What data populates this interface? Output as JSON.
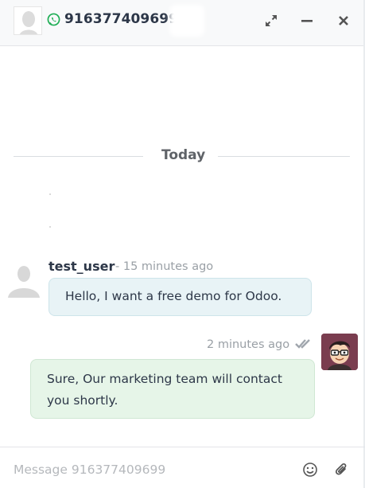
{
  "header": {
    "title": "916377409699",
    "avatar_icon": "user-avatar-icon",
    "channel_icon": "whatsapp-icon",
    "actions": [
      {
        "name": "expand-icon",
        "label": "Expand"
      },
      {
        "name": "minimize-icon",
        "label": "Minimize"
      },
      {
        "name": "close-icon",
        "label": "Close"
      }
    ]
  },
  "separator": {
    "label": "Today"
  },
  "messages": [
    {
      "author": "test_user",
      "time": "- 15 minutes ago",
      "body": "Hello, I want a free demo for Odoo.",
      "avatar_icon": "default-user-avatar-icon",
      "align": "left"
    },
    {
      "author": "",
      "time": "2 minutes ago",
      "body": "Sure, Our marketing team will contact you shortly.",
      "status_icon": "double-check-icon",
      "avatar_icon": "cartoon-user-avatar-icon",
      "align": "right"
    }
  ],
  "composer": {
    "placeholder": "Message 916377409699",
    "value": "",
    "icons": [
      "emoji-icon",
      "paperclip-icon"
    ]
  },
  "colors": {
    "header_bg": "#f8f9fa",
    "incoming_bubble": "#e8f3f6",
    "outgoing_bubble": "#e6f5e8",
    "whatsapp_green": "#25d366"
  }
}
